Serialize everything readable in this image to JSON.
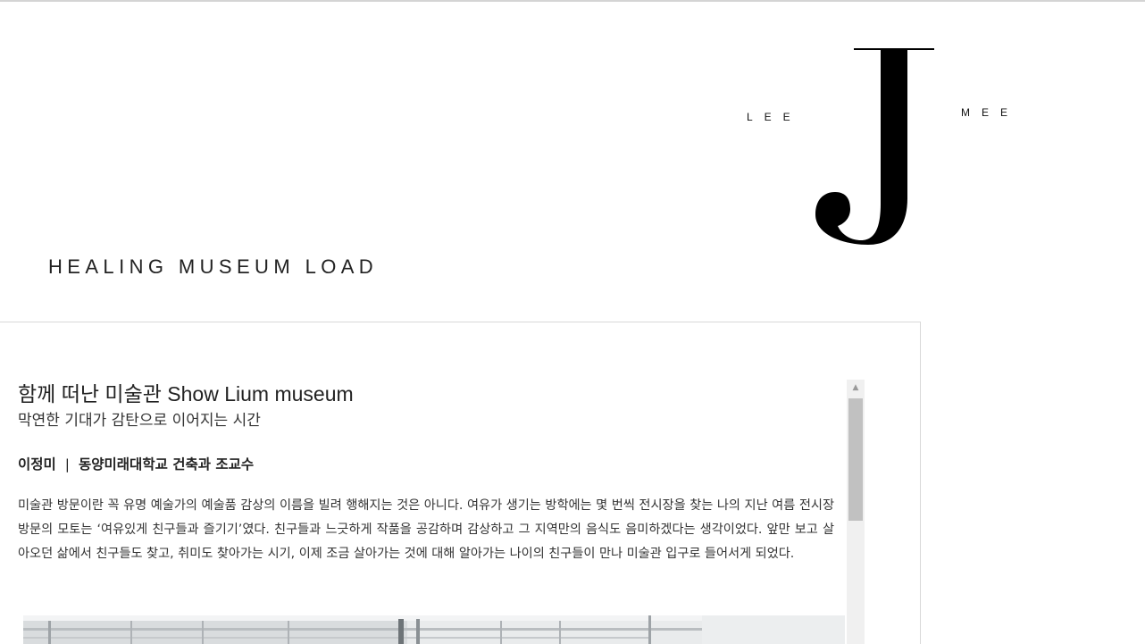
{
  "header": {
    "site_title": "HEALING MUSEUM LOAD",
    "logo": {
      "left_word": "LEE",
      "right_word": "MEE",
      "letter": "J"
    }
  },
  "article": {
    "title": "함께 떠난 미술관 Show Lium museum",
    "subtitle": "막연한 기대가 감탄으로 이어지는 시간",
    "author_name": "이정미",
    "byline_separator": "|",
    "author_affiliation": "동양미래대학교 건축과 조교수",
    "body": "미술관 방문이란 꼭 유명 예술가의 예술품 감상의 이름을 빌려 행해지는 것은 아니다. 여유가 생기는 방학에는 몇 번씩 전시장을 찾는 나의 지난 여름 전시장 방문의 모토는 ‘여유있게 친구들과 즐기기’였다. 친구들과 느긋하게 작품을 공감하며 감상하고 그 지역만의 음식도 음미하겠다는 생각이었다. 앞만 보고 살아오던 삶에서 친구들도 찾고, 취미도 찾아가는 시기, 이제 조금 살아가는 것에 대해 알아가는 나이의 친구들이 만나 미술관 입구로 들어서게 되었다."
  },
  "scrollbar": {
    "up_arrow_icon": "triangle-up-icon",
    "position_fraction": 0.0
  },
  "colors": {
    "text": "#222222",
    "border": "#d9d9d9",
    "scroll_track": "#f0f0f0",
    "scroll_thumb": "#c1c1c1"
  }
}
